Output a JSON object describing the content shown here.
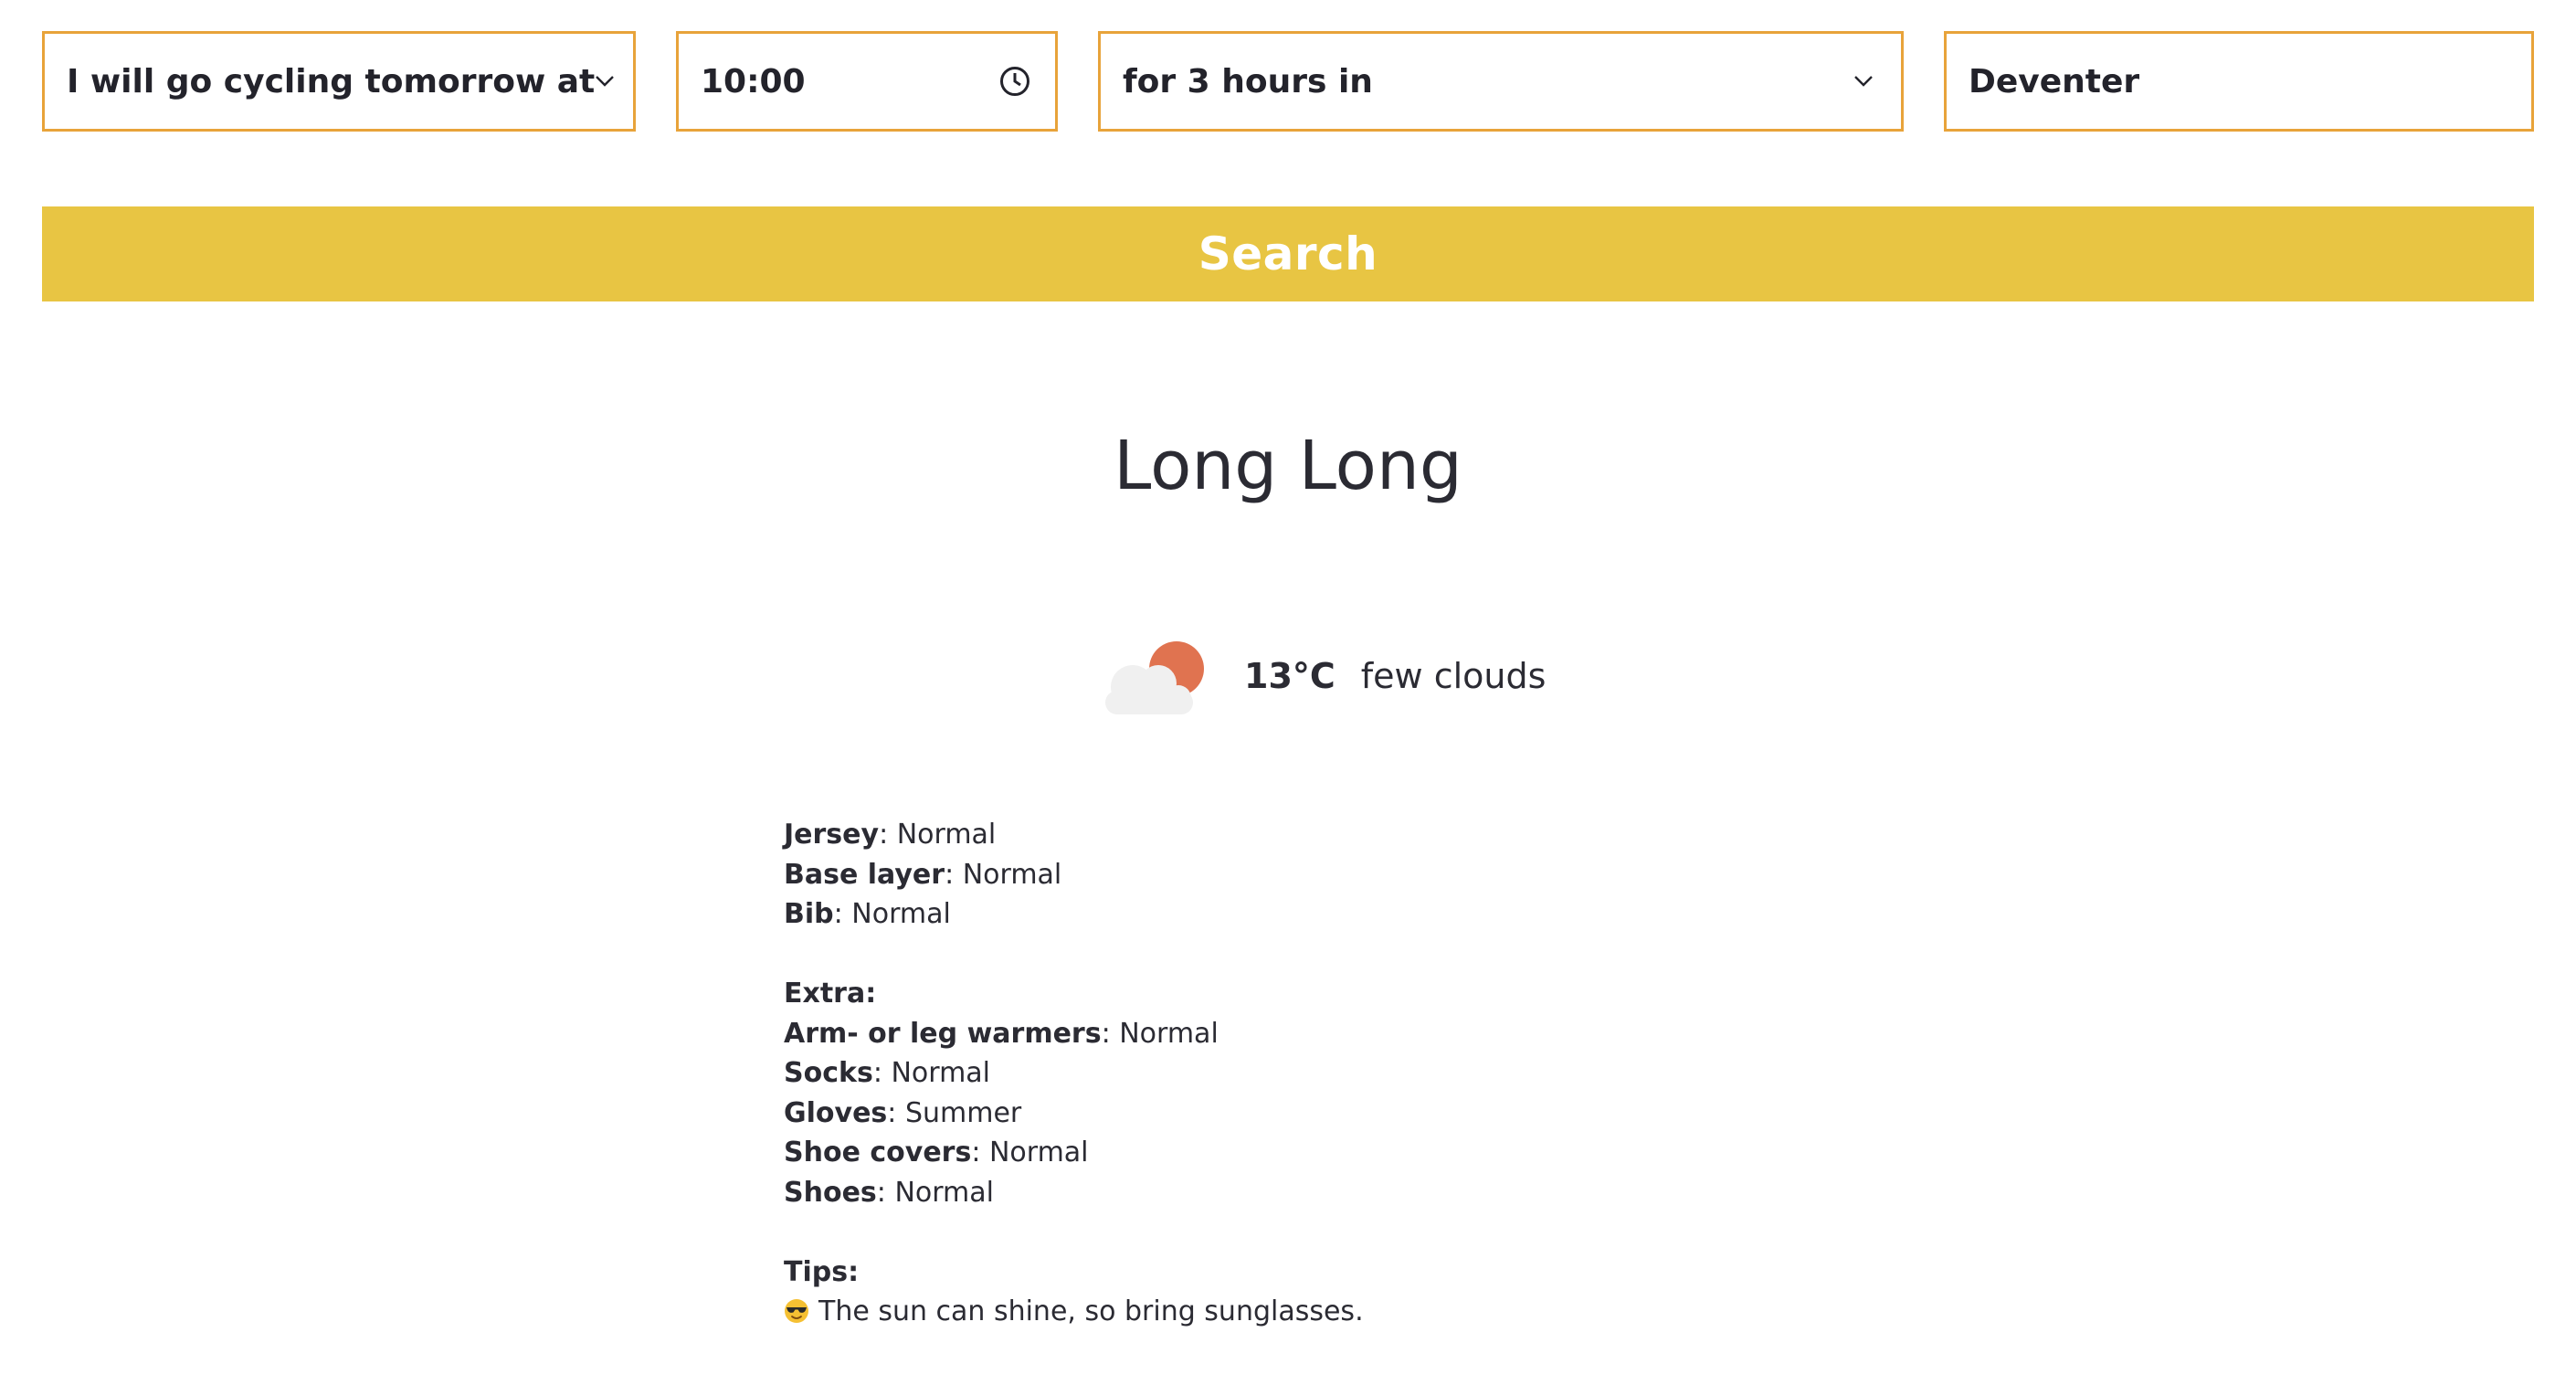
{
  "form": {
    "activity": "I will go cycling tomorrow at",
    "time": "10:00",
    "duration": "for 3 hours in",
    "city": "Deventer"
  },
  "search": {
    "label": "Search"
  },
  "result": {
    "title": "Long Long",
    "weather": {
      "icon": "few-clouds-icon",
      "temperature": "13°C",
      "description": "few clouds"
    },
    "clothing": [
      {
        "label": "Jersey",
        "value": "Normal"
      },
      {
        "label": "Base layer",
        "value": "Normal"
      },
      {
        "label": "Bib",
        "value": "Normal"
      }
    ],
    "extra_heading": "Extra:",
    "extra": [
      {
        "label": "Arm- or leg warmers",
        "value": "Normal"
      },
      {
        "label": "Socks",
        "value": "Normal"
      },
      {
        "label": "Gloves",
        "value": "Summer"
      },
      {
        "label": "Shoe covers",
        "value": "Normal"
      },
      {
        "label": "Shoes",
        "value": "Normal"
      }
    ],
    "tips_heading": "Tips:",
    "tips": [
      {
        "icon": "sunglasses-emoji-icon",
        "text": "The sun can shine, so bring sunglasses."
      }
    ]
  },
  "colors": {
    "field_border": "#e8a33a",
    "button_bg": "#e8c543",
    "sun": "#e07350",
    "cloud": "#f0f0f0"
  }
}
